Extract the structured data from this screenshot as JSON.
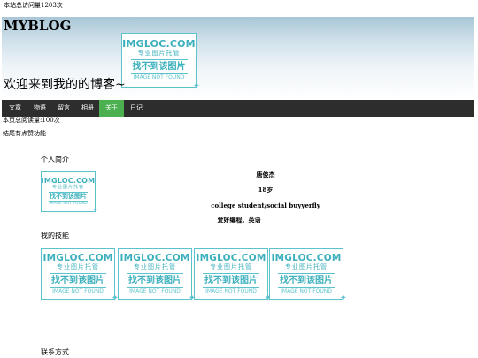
{
  "site_visits": "本站总访问量1203次",
  "header": {
    "logo": "MYBLOG",
    "welcome": "欢迎来到我的的博客~",
    "image": {
      "brand": "IMGLOC.COM",
      "sub": "专业图片托管",
      "main": "找不到该图片",
      "eng": "IMAGE NOT FOUND"
    }
  },
  "nav": {
    "items": [
      {
        "label": "文章"
      },
      {
        "label": "物语"
      },
      {
        "label": "留言"
      },
      {
        "label": "相册"
      },
      {
        "label": "关于"
      },
      {
        "label": "日记"
      }
    ],
    "active_index": 4,
    "active_color": "#4caf50",
    "bar_color": "#2d2d2d"
  },
  "blog_visits": "本页总阅读量:100次",
  "like_text": "结尾有点赞功能",
  "intro": {
    "title": "个人简介",
    "name": "唐俊杰",
    "age": "18岁",
    "role": "college student/social buyyerfly",
    "hobby": "爱好编程、英语"
  },
  "skills": {
    "title": "我的技能",
    "count": 4
  },
  "contact": {
    "title": "联系方式"
  },
  "icons": {
    "placeholder": "image-not-found-icon"
  }
}
